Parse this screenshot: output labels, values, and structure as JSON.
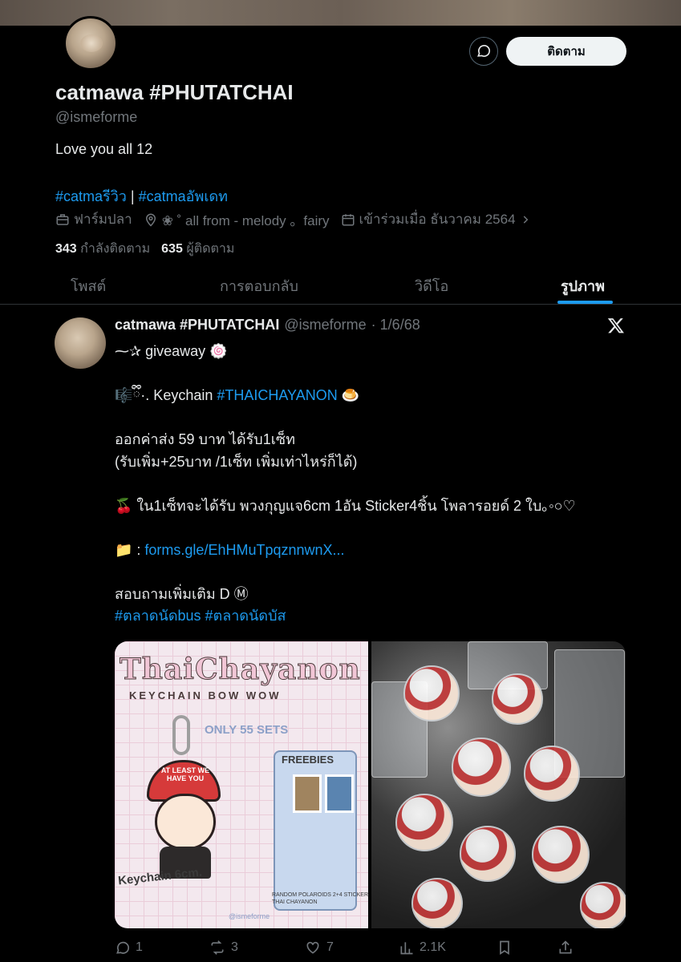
{
  "profile": {
    "name": "catmawa #PHUTATCHAI",
    "handle": "@ismeforme",
    "bio": "Love you all 12",
    "bio_tag1": "#catmaรีวิว",
    "bio_sep": " | ",
    "bio_tag2": "#catmaอัพเดท",
    "category": "ฟาร์มปลา",
    "location": "❀ ˚ all from - melody 。fairy",
    "joined": "เข้าร่วมเมื่อ ธันวาคม 2564",
    "following_count": "343",
    "following_label": "กำลังติดตาม",
    "followers_count": "635",
    "followers_label": "ผู้ติดตาม",
    "follow_button": "ติดตาม"
  },
  "tabs": [
    {
      "label": "โพสต์"
    },
    {
      "label": "การตอบกลับ"
    },
    {
      "label": "วิดีโอ"
    },
    {
      "label": "รูปภาพ",
      "active": true
    }
  ],
  "post": {
    "author_name": "catmawa #PHUTATCHAI",
    "author_handle": "@ismeforme",
    "date": "· 1/6/68",
    "line1": "⁓✰ giveaway 🍥",
    "line2_prefix": "🎼ྀི·. Keychain ",
    "line2_tag": "#THAICHAYANON",
    "line2_suffix": " 🍮",
    "line3": "ออกค่าส่ง 59 บาท ได้รับ1เซ็ท",
    "line4": "(รับเพิ่ม+25บาท /1เซ็ท เพิ่มเท่าไหร่ก็ได้)",
    "line5": "🍒 ใน1เซ็ทจะได้รับ พวงกุญแจ6cm 1อัน Sticker4ชิ้น โพลารอยด์ 2 ใบ｡◦○♡",
    "line6_prefix": "📁 : ",
    "line6_link": "forms.gle/EhHMuTpqznnwnX...",
    "line7": "สอบถามเพิ่มเติม D Ⓜ",
    "line8": "#ตลาดนัดbus #ตลาดนัดบัส"
  },
  "media": {
    "image1": {
      "title": "ThaiChayanon",
      "subtitle": "KEYCHAIN BOW WOW",
      "only": "ONLY 55 SETS",
      "freebies": "FREEBIES",
      "keychain_label": "Keychain 6cm.",
      "cap_text": "AT LEAST WE HAVE YOU",
      "credit": "@ismeforme",
      "random": "RANDOM POLAROIDS 2+4 STICKER THAI CHAYANON"
    }
  },
  "actions": {
    "replies": "1",
    "reposts": "3",
    "likes": "7",
    "views": "2.1K"
  },
  "colors": {
    "accent": "#1d9bf0",
    "background": "#000000",
    "muted": "#71767b"
  }
}
